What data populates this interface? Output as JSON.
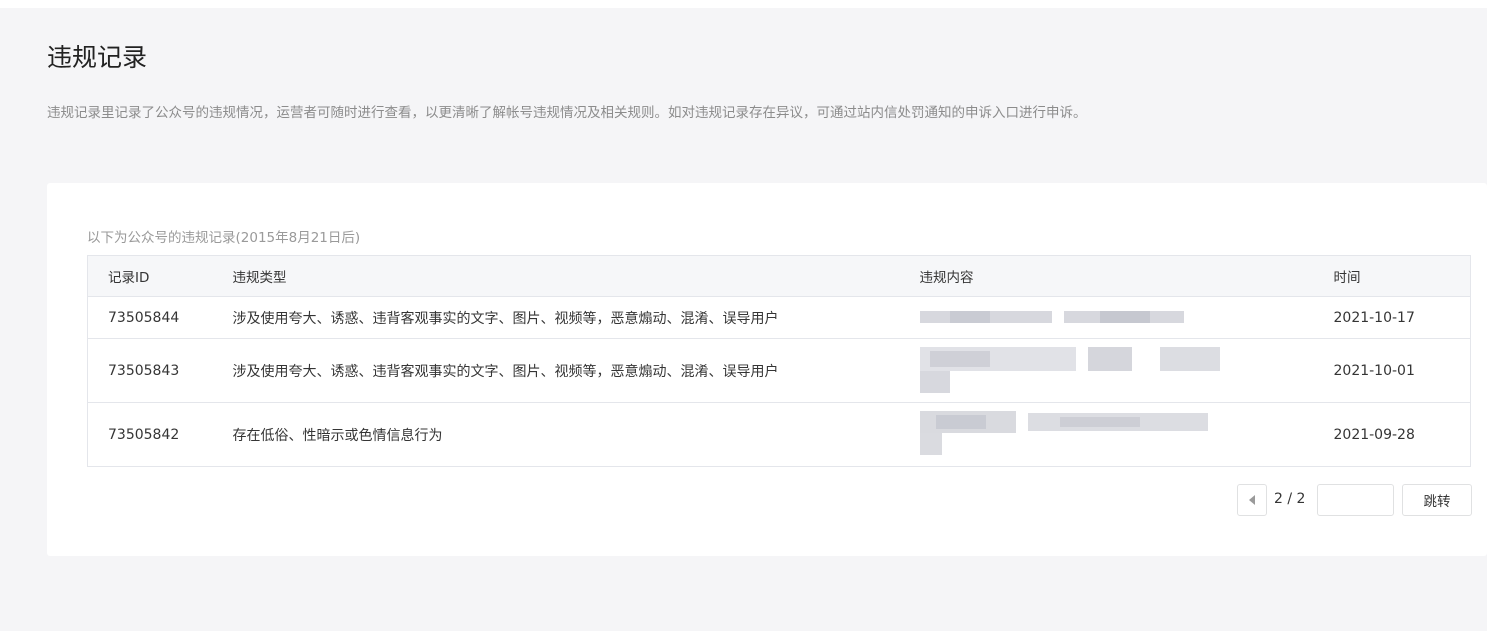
{
  "page": {
    "title": "违规记录",
    "description": "违规记录里记录了公众号的违规情况，运营者可随时进行查看，以更清晰了解帐号违规情况及相关规则。如对违规记录存在异议，可通过站内信处罚通知的申诉入口进行申诉。"
  },
  "table": {
    "caption": "以下为公众号的违规记录(2015年8月21日后)",
    "headers": {
      "id": "记录ID",
      "type": "违规类型",
      "content": "违规内容",
      "time": "时间"
    },
    "rows": [
      {
        "id": "73505844",
        "type": "涉及使用夸大、诱惑、违背客观事实的文字、图片、视频等，恶意煽动、混淆、误导用户",
        "time": "2021-10-17"
      },
      {
        "id": "73505843",
        "type": "涉及使用夸大、诱惑、违背客观事实的文字、图片、视频等，恶意煽动、混淆、误导用户",
        "time": "2021-10-01"
      },
      {
        "id": "73505842",
        "type": "存在低俗、性暗示或色情信息行为",
        "time": "2021-09-28"
      }
    ]
  },
  "pagination": {
    "current": "2 / 2",
    "jump_label": "跳转",
    "input_value": ""
  },
  "colors": {
    "background": "#f5f5f7",
    "card": "#ffffff",
    "header_bg": "#f6f7f9",
    "type_text": "#4a5a78",
    "muted": "#8c8c8c"
  },
  "icons": {
    "prev": "caret-left-icon"
  }
}
